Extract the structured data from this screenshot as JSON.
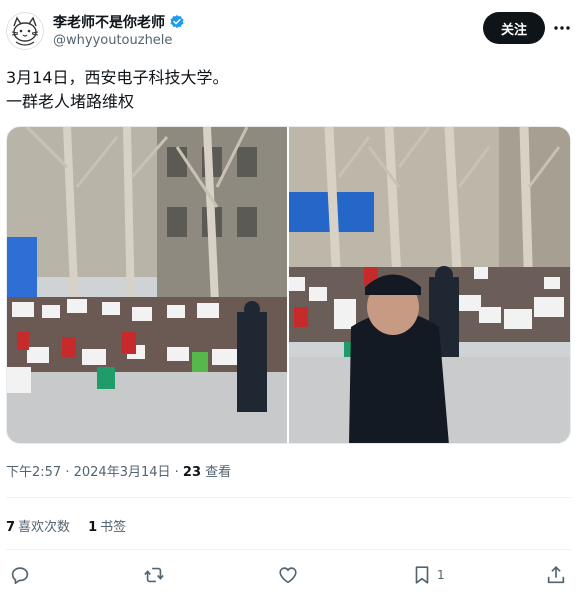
{
  "author": {
    "display_name": "李老师不是你老师",
    "handle": "@whyyoutouzhele",
    "verified": true
  },
  "header": {
    "follow_label": "关注",
    "more_label": "···"
  },
  "tweet": {
    "line1": "3月14日，西安电子科技大学。",
    "line2": "一群老人堵路维权"
  },
  "meta": {
    "time": "下午2:57",
    "sep1": " · ",
    "date": "2024年3月14日",
    "sep2": " · ",
    "views_count": "23",
    "views_label": " 查看"
  },
  "stats": {
    "likes_count": "7",
    "likes_label": "喜欢次数",
    "bookmarks_count": "1",
    "bookmarks_label": "书签"
  },
  "actions": {
    "reply_icon": "reply-icon",
    "retweet_icon": "retweet-icon",
    "like_icon": "heart-icon",
    "bookmark_icon": "bookmark-icon",
    "bookmark_count": "1",
    "share_icon": "share-icon"
  },
  "colors": {
    "text": "#0f1419",
    "secondary": "#536471",
    "verified": "#1d9bf0",
    "follow_bg": "#0f1419"
  }
}
